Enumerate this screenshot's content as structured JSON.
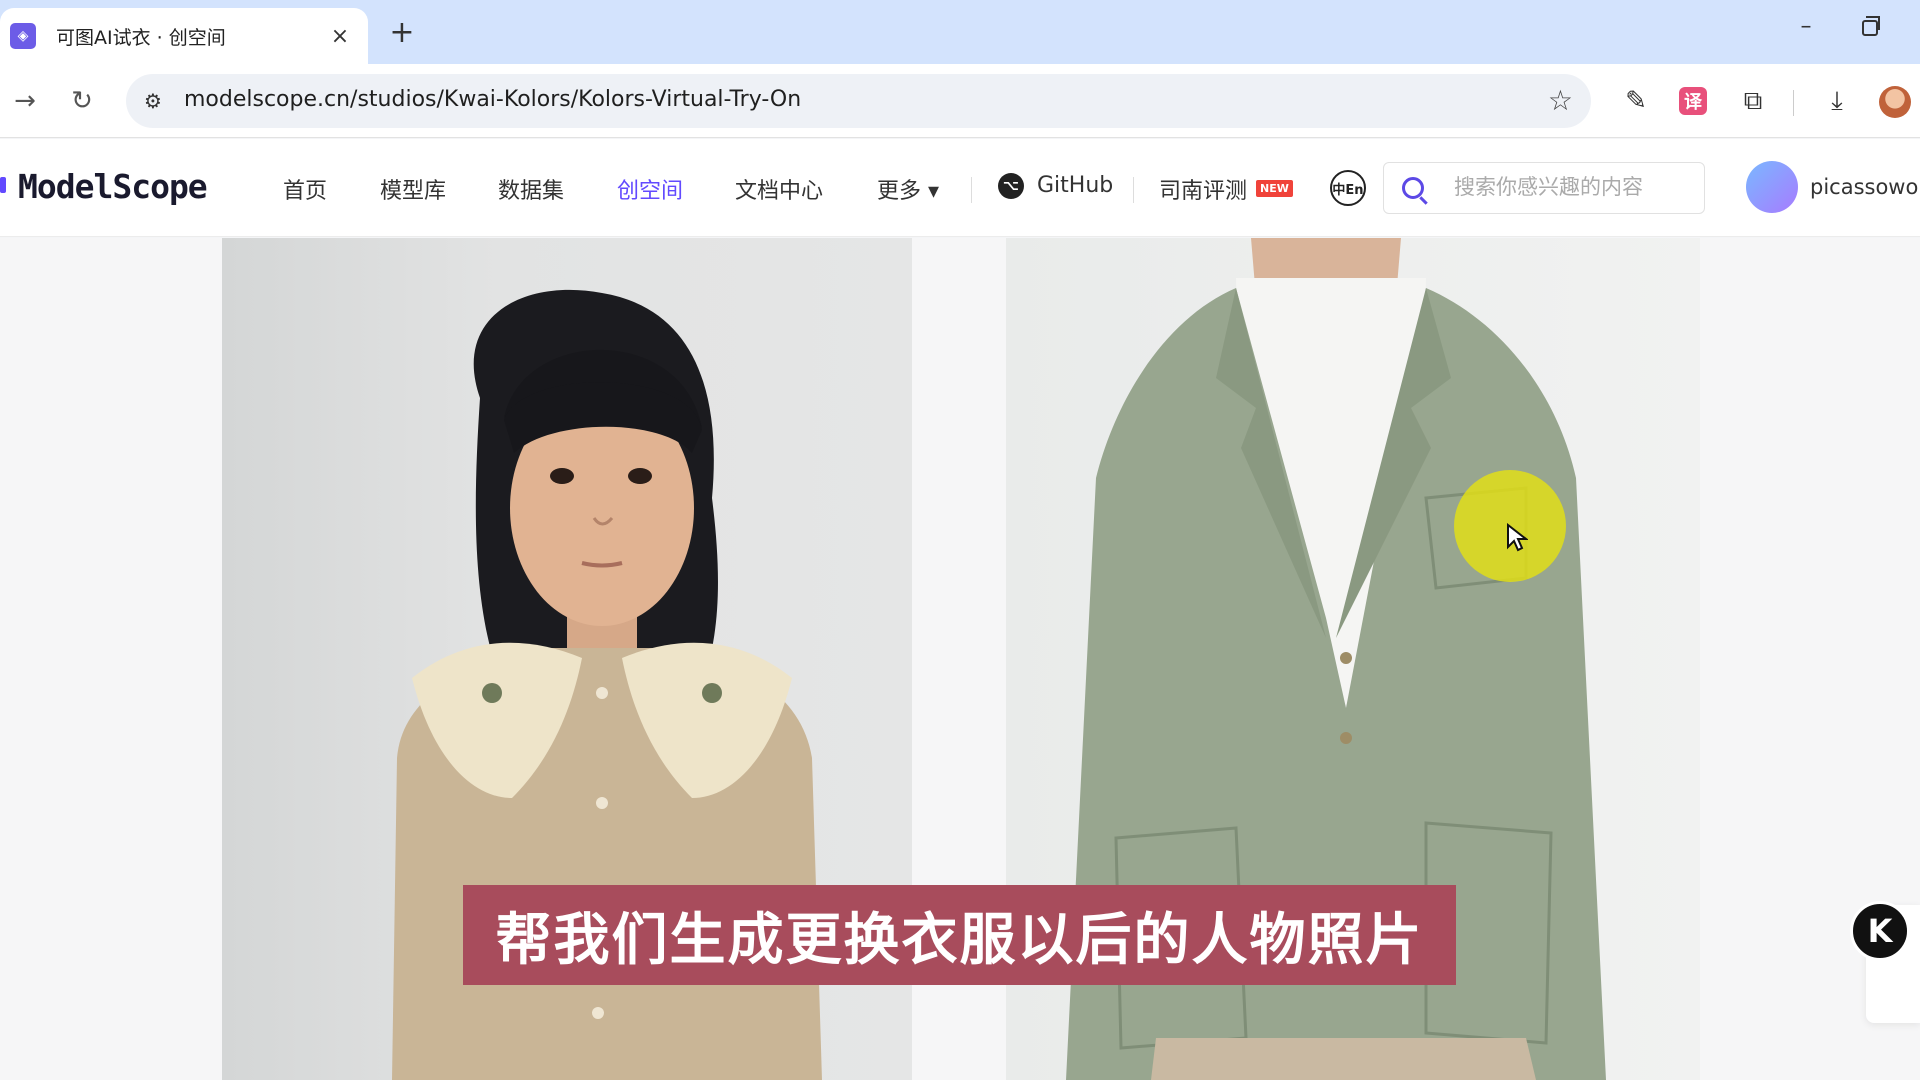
{
  "browser": {
    "tab_title": "可图AI试衣 · 创空间",
    "url": "modelscope.cn/studios/Kwai-Kolors/Kolors-Virtual-Try-On",
    "icons": {
      "close": "×",
      "new_tab": "+",
      "minimize": "–",
      "back": "→",
      "reload": "↻",
      "site_info": "⚙",
      "bookmark": "☆",
      "pen": "✎",
      "translate": "译",
      "extensions": "⧉",
      "download": "⤓"
    }
  },
  "site": {
    "logo": "ModelScope",
    "nav": {
      "home": "首页",
      "models": "模型库",
      "datasets": "数据集",
      "studios": "创空间",
      "docs": "文档中心",
      "more": "更多 ▾",
      "github": "GitHub",
      "review": "司南评测",
      "new_badge": "NEW",
      "lang": "中En"
    },
    "search_placeholder": "搜索你感兴趣的内容",
    "username": "picassowor",
    "active_color": "#624aff"
  },
  "content": {
    "subtitle": "帮我们生成更换衣服以后的人物照片",
    "float_button": "K"
  }
}
